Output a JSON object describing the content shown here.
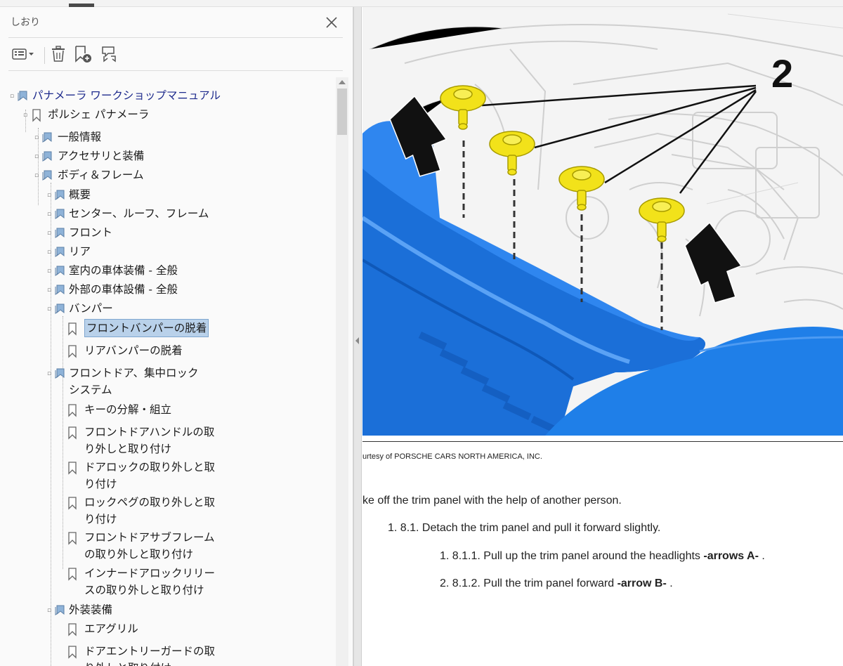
{
  "sidebar": {
    "title": "しおり",
    "close_icon": "close-icon",
    "toolbar": {
      "options_icon": "list-options-icon",
      "delete_icon": "trash-icon",
      "new_bookmark_icon": "add-bookmark-icon",
      "expand_icon": "bookmark-expand-icon"
    },
    "tree": [
      {
        "label": "パナメーラ ワークショップマニュアル",
        "level": 0,
        "type": "book",
        "expanded": true
      },
      {
        "label": "ポルシェ パナメーラ",
        "level": 1,
        "type": "bookmark",
        "expanded": true
      },
      {
        "label": "一般情報",
        "level": 2,
        "type": "book",
        "expanded": false
      },
      {
        "label": "アクセサリと装備",
        "level": 2,
        "type": "book",
        "expanded": false
      },
      {
        "label": "ボディ＆フレーム",
        "level": 2,
        "type": "book",
        "expanded": true
      },
      {
        "label": "概要",
        "level": 3,
        "type": "book"
      },
      {
        "label": "センター、ルーフ、フレーム",
        "level": 3,
        "type": "book"
      },
      {
        "label": "フロント",
        "level": 3,
        "type": "book"
      },
      {
        "label": "リア",
        "level": 3,
        "type": "book"
      },
      {
        "label": "室内の車体装備 - 全般",
        "level": 3,
        "type": "book"
      },
      {
        "label": "外部の車体設備 - 全般",
        "level": 3,
        "type": "book"
      },
      {
        "label": "バンパー",
        "level": 3,
        "type": "book",
        "expanded": true
      },
      {
        "label": "フロントバンパーの脱着",
        "level": 4,
        "type": "bookmark",
        "selected": true
      },
      {
        "label": "リアバンパーの脱着",
        "level": 4,
        "type": "bookmark"
      },
      {
        "label": "フロントドア、集中ロックシステム",
        "level": 3,
        "type": "book",
        "expanded": true
      },
      {
        "label": "キーの分解・組立",
        "level": 4,
        "type": "bookmark"
      },
      {
        "label": "フロントドアハンドルの取り外しと取り付け",
        "level": 4,
        "type": "bookmark"
      },
      {
        "label": "ドアロックの取り外しと取り付け",
        "level": 4,
        "type": "bookmark"
      },
      {
        "label": "ロックペグの取り外しと取り付け",
        "level": 4,
        "type": "bookmark"
      },
      {
        "label": "フロントドアサブフレームの取り外しと取り付け",
        "level": 4,
        "type": "bookmark"
      },
      {
        "label": "インナードアロックリリースの取り外しと取り付け",
        "level": 4,
        "type": "bookmark"
      },
      {
        "label": "外装装備",
        "level": 3,
        "type": "book",
        "expanded": true
      },
      {
        "label": "エアグリル",
        "level": 4,
        "type": "bookmark"
      },
      {
        "label": "ドアエントリーガードの取り外しと取り付け",
        "level": 4,
        "type": "bookmark"
      }
    ]
  },
  "document": {
    "figure_callout": "2",
    "credit": "urtesy of PORSCHE CARS NORTH AMERICA, INC.",
    "step_main": "ke off the trim panel with the help of another person.",
    "step_8_1": "1. 8.1. Detach the trim panel and pull it forward slightly.",
    "step_8_1_1_text": "1. 8.1.1. Pull up the trim panel around the headlights ",
    "step_8_1_1_bold": "-arrows A-",
    "step_8_1_1_end": " .",
    "step_8_1_2_text": "2. 8.1.2. Pull the trim panel forward ",
    "step_8_1_2_bold": "-arrow B-",
    "step_8_1_2_end": " ."
  },
  "colors": {
    "bumper_blue": "#1f7fe8",
    "clip_yellow": "#f2e21a",
    "selection": "#b9d1ea",
    "root_link": "#1d2a8c"
  }
}
